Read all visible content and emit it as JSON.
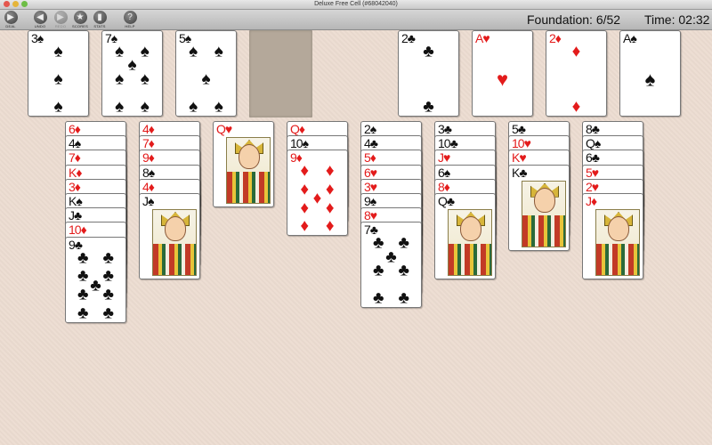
{
  "window": {
    "title": "Deluxe Free Cell (#68042040)"
  },
  "toolbar": {
    "buttons": [
      {
        "label": "DEAL",
        "icon": "play-icon",
        "glyph": "▶",
        "enabled": true
      },
      {
        "label": "UNDO",
        "icon": "undo-arrow-icon",
        "glyph": "◀",
        "enabled": true
      },
      {
        "label": "REDO",
        "icon": "redo-arrow-icon",
        "glyph": "▶",
        "enabled": false
      },
      {
        "label": "SCORES",
        "icon": "star-icon",
        "glyph": "★",
        "enabled": true
      },
      {
        "label": "STATS",
        "icon": "bar-chart-icon",
        "glyph": "▮",
        "enabled": true
      },
      {
        "label": "HELP",
        "icon": "help-icon",
        "glyph": "?",
        "enabled": true
      }
    ]
  },
  "status": {
    "foundation": "Foundation: 6/52",
    "time": "Time: 02:32"
  },
  "free_cells": [
    {
      "rank": "3",
      "suit": "♠",
      "color": "black"
    },
    {
      "rank": "7",
      "suit": "♠",
      "color": "black"
    },
    {
      "rank": "5",
      "suit": "♠",
      "color": "black"
    },
    null
  ],
  "foundations": [
    {
      "rank": "2",
      "suit": "♣",
      "color": "black"
    },
    {
      "rank": "A",
      "suit": "♥",
      "color": "red"
    },
    {
      "rank": "2",
      "suit": "♦",
      "color": "red"
    },
    {
      "rank": "A",
      "suit": "♠",
      "color": "black"
    }
  ],
  "tableau": [
    [
      {
        "rank": "6",
        "suit": "♦",
        "color": "red"
      },
      {
        "rank": "4",
        "suit": "♠",
        "color": "black"
      },
      {
        "rank": "7",
        "suit": "♦",
        "color": "red"
      },
      {
        "rank": "K",
        "suit": "♦",
        "color": "red"
      },
      {
        "rank": "3",
        "suit": "♦",
        "color": "red"
      },
      {
        "rank": "K",
        "suit": "♠",
        "color": "black"
      },
      {
        "rank": "J",
        "suit": "♣",
        "color": "black"
      },
      {
        "rank": "10",
        "suit": "♦",
        "color": "red"
      },
      {
        "rank": "9",
        "suit": "♣",
        "color": "black"
      }
    ],
    [
      {
        "rank": "4",
        "suit": "♦",
        "color": "red"
      },
      {
        "rank": "7",
        "suit": "♦",
        "color": "red"
      },
      {
        "rank": "9",
        "suit": "♦",
        "color": "red"
      },
      {
        "rank": "8",
        "suit": "♠",
        "color": "black"
      },
      {
        "rank": "4",
        "suit": "♦",
        "color": "red"
      },
      {
        "rank": "J",
        "suit": "♠",
        "color": "black"
      }
    ],
    [
      {
        "rank": "Q",
        "suit": "♥",
        "color": "red"
      }
    ],
    [
      {
        "rank": "Q",
        "suit": "♦",
        "color": "red"
      },
      {
        "rank": "10",
        "suit": "♠",
        "color": "black"
      },
      {
        "rank": "9",
        "suit": "♦",
        "color": "red"
      }
    ],
    [
      {
        "rank": "2",
        "suit": "♠",
        "color": "black"
      },
      {
        "rank": "4",
        "suit": "♣",
        "color": "black"
      },
      {
        "rank": "5",
        "suit": "♦",
        "color": "red"
      },
      {
        "rank": "6",
        "suit": "♥",
        "color": "red"
      },
      {
        "rank": "3",
        "suit": "♥",
        "color": "red"
      },
      {
        "rank": "9",
        "suit": "♠",
        "color": "black"
      },
      {
        "rank": "8",
        "suit": "♥",
        "color": "red"
      },
      {
        "rank": "7",
        "suit": "♣",
        "color": "black"
      }
    ],
    [
      {
        "rank": "3",
        "suit": "♣",
        "color": "black"
      },
      {
        "rank": "10",
        "suit": "♣",
        "color": "black"
      },
      {
        "rank": "J",
        "suit": "♥",
        "color": "red"
      },
      {
        "rank": "6",
        "suit": "♠",
        "color": "black"
      },
      {
        "rank": "8",
        "suit": "♦",
        "color": "red"
      },
      {
        "rank": "Q",
        "suit": "♣",
        "color": "black"
      }
    ],
    [
      {
        "rank": "5",
        "suit": "♣",
        "color": "black"
      },
      {
        "rank": "10",
        "suit": "♥",
        "color": "red"
      },
      {
        "rank": "K",
        "suit": "♥",
        "color": "red"
      },
      {
        "rank": "K",
        "suit": "♣",
        "color": "black"
      }
    ],
    [
      {
        "rank": "8",
        "suit": "♣",
        "color": "black"
      },
      {
        "rank": "Q",
        "suit": "♠",
        "color": "black"
      },
      {
        "rank": "6",
        "suit": "♣",
        "color": "black"
      },
      {
        "rank": "5",
        "suit": "♥",
        "color": "red"
      },
      {
        "rank": "2",
        "suit": "♥",
        "color": "red"
      },
      {
        "rank": "J",
        "suit": "♦",
        "color": "red"
      }
    ]
  ],
  "colors": {
    "red_suit": "#e31b1b",
    "black_suit": "#111111",
    "felt": "#ecdcd1",
    "empty_cell": "#b4a89a"
  }
}
